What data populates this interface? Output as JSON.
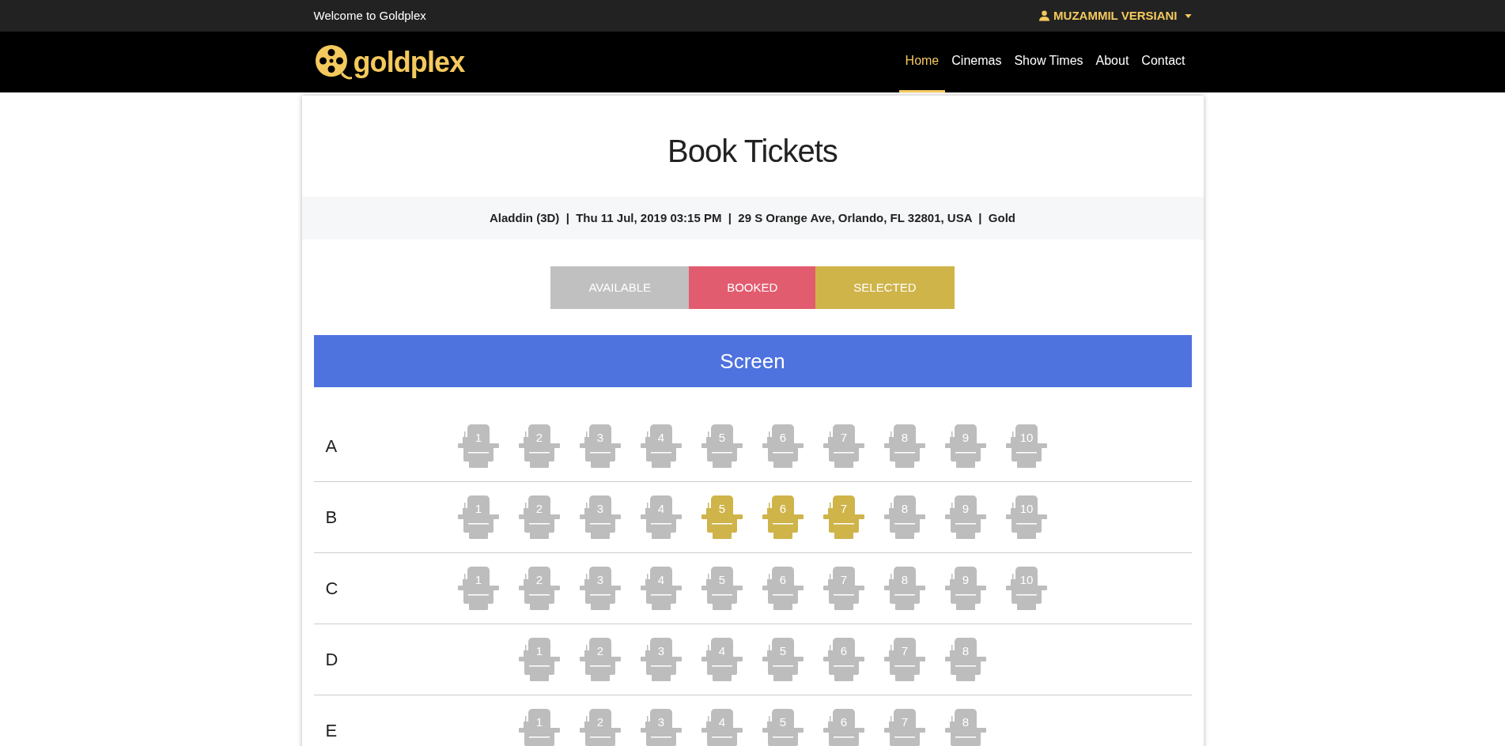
{
  "topbar": {
    "welcome": "Welcome to Goldplex",
    "user": "MUZAMMIL VERSIANI"
  },
  "navbar": {
    "logo": "goldplex",
    "links": [
      {
        "label": "Home",
        "selected": true
      },
      {
        "label": "Cinemas",
        "selected": false
      },
      {
        "label": "Show Times",
        "selected": false
      },
      {
        "label": "About",
        "selected": false
      },
      {
        "label": "Contact",
        "selected": false
      }
    ]
  },
  "title": "Book Tickets",
  "details": "Aladdin (3D)  |  Thu 11 Jul, 2019 03:15 PM  |  29 S Orange Ave, Orlando, FL 32801, USA  |  Gold",
  "legend": [
    {
      "label": "AVAILABLE",
      "color": "#c0c0c0"
    },
    {
      "label": "BOOKED",
      "color": "#e25c6f"
    },
    {
      "label": "SELECTED",
      "color": "#cfb44a"
    }
  ],
  "screen": "Screen",
  "rows": [
    {
      "label": "A",
      "seats": [
        {
          "number": "1",
          "selected": false
        },
        {
          "number": "2",
          "selected": false
        },
        {
          "number": "3",
          "selected": false
        },
        {
          "number": "4",
          "selected": false
        },
        {
          "number": "5",
          "selected": false
        },
        {
          "number": "6",
          "selected": false
        },
        {
          "number": "7",
          "selected": false
        },
        {
          "number": "8",
          "selected": false
        },
        {
          "number": "9",
          "selected": false
        },
        {
          "number": "10",
          "selected": false
        }
      ]
    },
    {
      "label": "B",
      "seats": [
        {
          "number": "1",
          "selected": false
        },
        {
          "number": "2",
          "selected": false
        },
        {
          "number": "3",
          "selected": false
        },
        {
          "number": "4",
          "selected": false
        },
        {
          "number": "5",
          "selected": true
        },
        {
          "number": "6",
          "selected": true
        },
        {
          "number": "7",
          "selected": true
        },
        {
          "number": "8",
          "selected": false
        },
        {
          "number": "9",
          "selected": false
        },
        {
          "number": "10",
          "selected": false
        }
      ]
    },
    {
      "label": "C",
      "seats": [
        {
          "number": "1",
          "selected": false
        },
        {
          "number": "2",
          "selected": false
        },
        {
          "number": "3",
          "selected": false
        },
        {
          "number": "4",
          "selected": false
        },
        {
          "number": "5",
          "selected": false
        },
        {
          "number": "6",
          "selected": false
        },
        {
          "number": "7",
          "selected": false
        },
        {
          "number": "8",
          "selected": false
        },
        {
          "number": "9",
          "selected": false
        },
        {
          "number": "10",
          "selected": false
        }
      ]
    },
    {
      "label": "D",
      "seats": [
        {
          "number": "1",
          "selected": false
        },
        {
          "number": "2",
          "selected": false
        },
        {
          "number": "3",
          "selected": false
        },
        {
          "number": "4",
          "selected": false
        },
        {
          "number": "5",
          "selected": false
        },
        {
          "number": "6",
          "selected": false
        },
        {
          "number": "7",
          "selected": false
        },
        {
          "number": "8",
          "selected": false
        }
      ]
    },
    {
      "label": "E",
      "seats": [
        {
          "number": "1",
          "selected": false
        },
        {
          "number": "2",
          "selected": false
        },
        {
          "number": "3",
          "selected": false
        },
        {
          "number": "4",
          "selected": false
        },
        {
          "number": "5",
          "selected": false
        },
        {
          "number": "6",
          "selected": false
        },
        {
          "number": "7",
          "selected": false
        },
        {
          "number": "8",
          "selected": false
        }
      ]
    }
  ]
}
